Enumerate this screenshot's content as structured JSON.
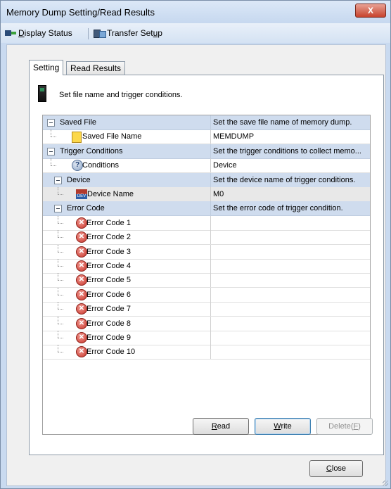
{
  "window": {
    "title": "Memory Dump Setting/Read Results",
    "close_symbol": "X"
  },
  "toolbar": {
    "display_status": {
      "label_pre": "",
      "accel": "D",
      "label_post": "isplay Status",
      "icon": "display-status-icon"
    },
    "transfer_setup": {
      "label_pre": "Transfer Set",
      "accel": "u",
      "label_post": "p",
      "icon": "transfer-setup-icon"
    }
  },
  "tabs": [
    {
      "label": "Setting",
      "active": true
    },
    {
      "label": "Read Results",
      "active": false
    }
  ],
  "header": {
    "text": "Set file name and trigger conditions.",
    "icon": "plc-cpu-icon"
  },
  "grid": {
    "rows": [
      {
        "kind": "category",
        "label": "Saved File",
        "value": "Set the save file name of memory dump."
      },
      {
        "kind": "item",
        "icon": "file-icon",
        "label": "Saved File Name",
        "value": "MEMDUMP"
      },
      {
        "kind": "category",
        "label": "Trigger Conditions",
        "value": "Set the trigger conditions to collect memo..."
      },
      {
        "kind": "item",
        "icon": "question-icon",
        "label": "Conditions",
        "value": "Device"
      },
      {
        "kind": "category",
        "label": "Device",
        "value": "Set the device name of trigger conditions."
      },
      {
        "kind": "item",
        "icon": "device-icon",
        "label": "Device Name",
        "value": "M0"
      },
      {
        "kind": "category",
        "label": "Error Code",
        "value": "Set the error code of trigger condition."
      },
      {
        "kind": "item",
        "icon": "error-icon",
        "label": "Error Code 1",
        "value": ""
      },
      {
        "kind": "item",
        "icon": "error-icon",
        "label": "Error Code 2",
        "value": ""
      },
      {
        "kind": "item",
        "icon": "error-icon",
        "label": "Error Code 3",
        "value": ""
      },
      {
        "kind": "item",
        "icon": "error-icon",
        "label": "Error Code 4",
        "value": ""
      },
      {
        "kind": "item",
        "icon": "error-icon",
        "label": "Error Code 5",
        "value": ""
      },
      {
        "kind": "item",
        "icon": "error-icon",
        "label": "Error Code 6",
        "value": ""
      },
      {
        "kind": "item",
        "icon": "error-icon",
        "label": "Error Code 7",
        "value": ""
      },
      {
        "kind": "item",
        "icon": "error-icon",
        "label": "Error Code 8",
        "value": ""
      },
      {
        "kind": "item",
        "icon": "error-icon",
        "label": "Error Code 9",
        "value": ""
      },
      {
        "kind": "item",
        "icon": "error-icon",
        "label": "Error Code 10",
        "value": ""
      }
    ]
  },
  "buttons": {
    "read": {
      "pre": "",
      "accel": "R",
      "post": "ead"
    },
    "write": {
      "pre": "",
      "accel": "W",
      "post": "rite"
    },
    "delete": {
      "pre": "Delete(",
      "accel": "F",
      "post": ")"
    },
    "close": {
      "pre": "",
      "accel": "C",
      "post": "lose"
    }
  },
  "colors": {
    "category_row": "#cfdcee",
    "title_bar": "#c9daf0",
    "close_button": "#c7432d"
  }
}
